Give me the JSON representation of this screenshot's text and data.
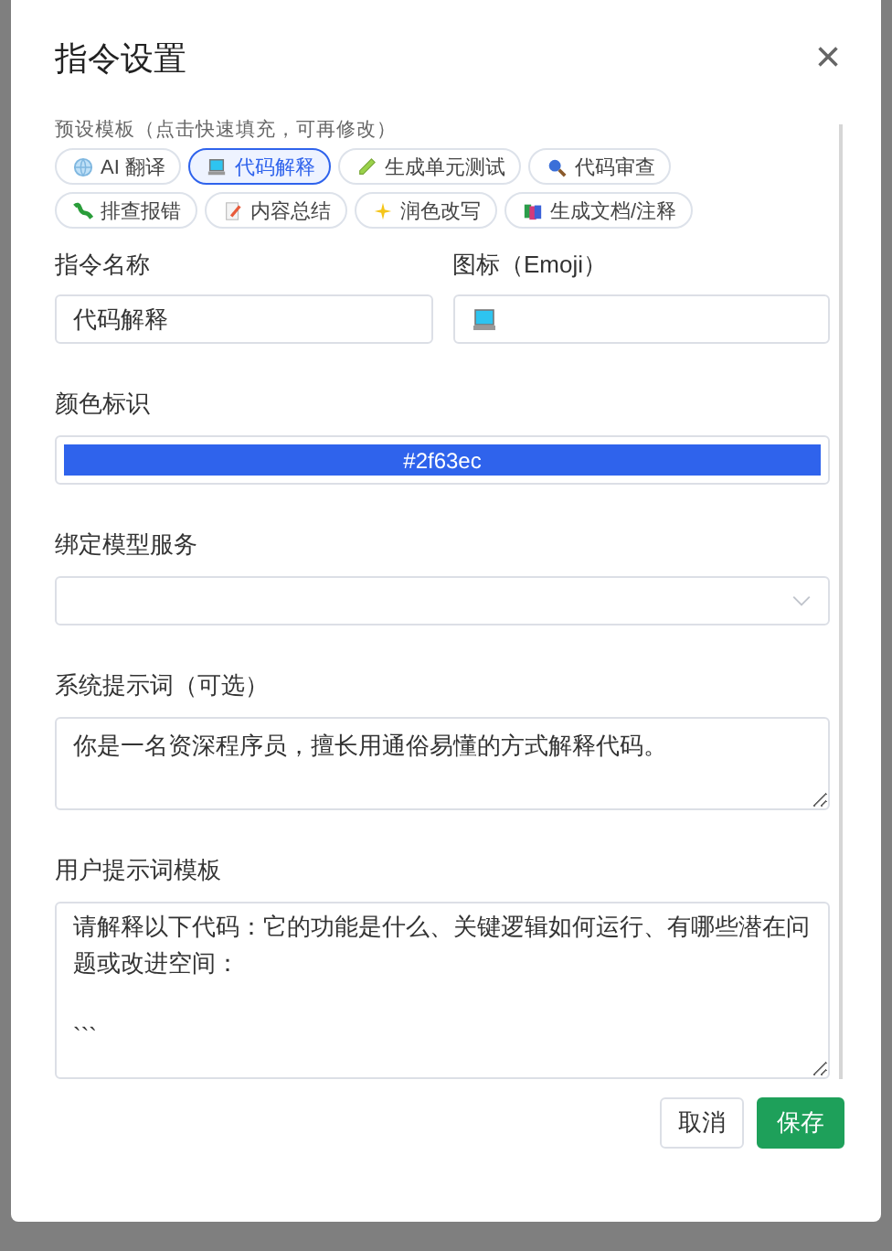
{
  "dialog": {
    "title": "指令设置",
    "close": "×"
  },
  "presets": {
    "label": "预设模板（点击快速填充，可再修改）",
    "chips": [
      {
        "label": "AI 翻译",
        "selected": false
      },
      {
        "label": "代码解释",
        "selected": true
      },
      {
        "label": "生成单元测试",
        "selected": false
      },
      {
        "label": "代码审查",
        "selected": false
      },
      {
        "label": "排查报错",
        "selected": false
      },
      {
        "label": "内容总结",
        "selected": false
      },
      {
        "label": "润色改写",
        "selected": false
      },
      {
        "label": "生成文档/注释",
        "selected": false
      }
    ]
  },
  "name_field": {
    "label": "指令名称",
    "value": "代码解释"
  },
  "icon_field": {
    "label": "图标（Emoji）"
  },
  "color_field": {
    "label": "颜色标识",
    "value": "#2f63ec",
    "color": "#2f63ec"
  },
  "model_field": {
    "label": "绑定模型服务"
  },
  "system_prompt": {
    "label": "系统提示词（可选）",
    "value": "你是一名资深程序员，擅长用通俗易懂的方式解释代码。"
  },
  "user_template": {
    "label": "用户提示词模板",
    "value": "请解释以下代码：它的功能是什么、关键逻辑如何运行、有哪些潜在问题或改进空间：\n\n```"
  },
  "buttons": {
    "cancel": "取消",
    "save": "保存"
  }
}
